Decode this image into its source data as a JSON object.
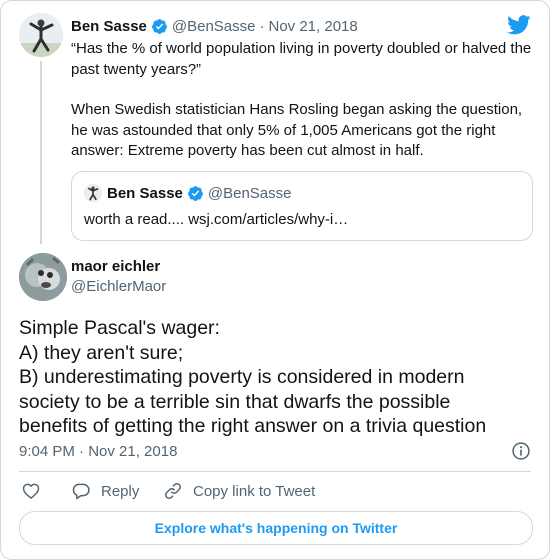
{
  "colors": {
    "accent": "#1d9bf0",
    "text": "#0f1419",
    "muted": "#536471",
    "border": "#cfd9de"
  },
  "parent_tweet": {
    "name": "Ben Sasse",
    "handle": "@BenSasse",
    "separator": "·",
    "date": "Nov 21, 2018",
    "text_line1": "“Has the % of world population living in poverty doubled or halved the past twenty years?”",
    "text_line2": "When Swedish statistician Hans Rosling began asking the question, he was astounded that only 5% of 1,005 Americans got the right answer: Extreme poverty has been cut almost in half."
  },
  "quoted_tweet": {
    "name": "Ben Sasse",
    "handle": "@BenSasse",
    "text": "worth a read.... wsj.com/articles/why-i…"
  },
  "main_tweet": {
    "name": "maor eichler",
    "handle": "@EichlerMaor",
    "lines": [
      "Simple Pascal's wager:",
      "A) they aren't sure;",
      "B) underestimating poverty is considered in modern",
      "society to be a terrible sin that dwarfs the possible",
      "benefits of getting the right answer on a trivia question"
    ],
    "timestamp": "9:04 PM · Nov 21, 2018"
  },
  "actions": {
    "reply_label": "Reply",
    "copy_label": "Copy link to Tweet"
  },
  "footer": {
    "explore_label": "Explore what's happening on Twitter"
  },
  "icons": [
    "verified-badge-icon",
    "twitter-bird-icon",
    "info-icon",
    "heart-icon",
    "reply-icon",
    "link-icon"
  ]
}
